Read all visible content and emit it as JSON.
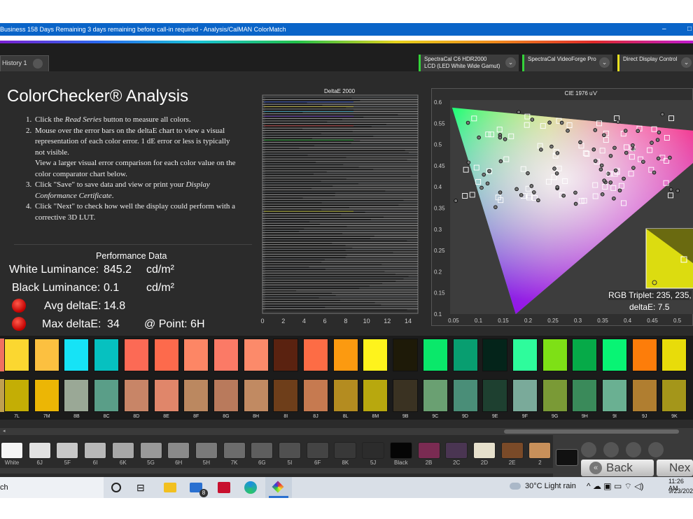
{
  "window": {
    "title": "Business 158 Days Remaining 3 days remaining before call-in required - Analysis/CalMAN ColorMatch",
    "minimize": "–",
    "maximize": "□"
  },
  "tabs": [
    {
      "label": "History 1"
    }
  ],
  "devices": [
    {
      "line1": "SpectraCal C6 HDR2000",
      "line2": "LCD (LED White Wide Gamut)",
      "color": "#34d23a"
    },
    {
      "line1": "SpectraCal VideoForge Pro",
      "line2": "",
      "color": "#34d23a"
    },
    {
      "line1": "Direct Display Control",
      "line2": "",
      "color": "#e8e020"
    }
  ],
  "page_title": "ColorChecker® Analysis",
  "instructions": [
    {
      "n": "1.",
      "html": "Click the <i>Read Series</i> button to measure all colors."
    },
    {
      "n": "2.",
      "html": "Mouse over the error bars on the deltaE chart to view a visual representation of each color error. 1 dE error or less is typically not visible.<br>View a larger visual error comparison for each color value on the color comparator chart below."
    },
    {
      "n": "3.",
      "html": "Click \"Save\" to save data and view or print your <i>Display Conformance Certificate</i>."
    },
    {
      "n": "4.",
      "html": "Click \"Next\" to check how well the display could perform with a corrective 3D LUT."
    }
  ],
  "performance": {
    "heading": "Performance Data",
    "white_label": "White Luminance:",
    "white_value": "845.2",
    "white_unit": "cd/m²",
    "black_label": "Black Luminance:",
    "black_value": "0.1",
    "black_unit": "cd/m²",
    "avg_label": "Avg deltaE:",
    "avg_value": "14.8",
    "max_label": "Max deltaE:",
    "max_value": "34",
    "point_label": "@ Point: 6H"
  },
  "deltae_chart": {
    "title": "DeltaE 2000",
    "xticks": [
      "0",
      "2",
      "4",
      "6",
      "8",
      "10",
      "12",
      "14"
    ]
  },
  "cie_chart": {
    "title": "CIE 1976 u'v'",
    "xticks": [
      "0.05",
      "0.1",
      "0.15",
      "0.2",
      "0.25",
      "0.3",
      "0.35",
      "0.4",
      "0.45",
      "0.5"
    ],
    "yticks": [
      "0.6",
      "0.55",
      "0.5",
      "0.45",
      "0.4",
      "0.35",
      "0.3",
      "0.25",
      "0.2",
      "0.15",
      "0.1"
    ],
    "rgb_triplet": "RGB Triplet: 235, 235,",
    "deltae": "deltaE: 7.5"
  },
  "swatches": [
    {
      "label": "7L",
      "top": "#fbd730",
      "bottom": "#c4ae05"
    },
    {
      "label": "7M",
      "top": "#fcc040",
      "bottom": "#ecb605"
    },
    {
      "label": "8B",
      "top": "#16e3f6",
      "bottom": "#9aa896"
    },
    {
      "label": "8C",
      "top": "#06c1c0",
      "bottom": "#5a9e88"
    },
    {
      "label": "8D",
      "top": "#fc6a55",
      "bottom": "#c88567"
    },
    {
      "label": "8E",
      "top": "#fd6a4c",
      "bottom": "#e0866a"
    },
    {
      "label": "8F",
      "top": "#fd8665",
      "bottom": "#bb8860"
    },
    {
      "label": "8G",
      "top": "#fb7a66",
      "bottom": "#b97a5c"
    },
    {
      "label": "8H",
      "top": "#fc8a6a",
      "bottom": "#c18a62"
    },
    {
      "label": "8I",
      "top": "#5a2210",
      "bottom": "#6e3e1a"
    },
    {
      "label": "8J",
      "top": "#fd6c45",
      "bottom": "#c67a50"
    },
    {
      "label": "8L",
      "top": "#fc9a10",
      "bottom": "#b48c20"
    },
    {
      "label": "8M",
      "top": "#fef31c",
      "bottom": "#b8a80e"
    },
    {
      "label": "9B",
      "top": "#1e1a08",
      "bottom": "#3a3222"
    },
    {
      "label": "9C",
      "top": "#0ae86a",
      "bottom": "#6aa072"
    },
    {
      "label": "9D",
      "top": "#089e70",
      "bottom": "#4a8e78"
    },
    {
      "label": "9E",
      "top": "#04241a",
      "bottom": "#1e4030"
    },
    {
      "label": "9F",
      "top": "#2efc9c",
      "bottom": "#7aaa9a"
    },
    {
      "label": "9G",
      "top": "#7ee016",
      "bottom": "#7a9a36"
    },
    {
      "label": "9H",
      "top": "#06aa48",
      "bottom": "#3a8a5a"
    },
    {
      "label": "9I",
      "top": "#08f474",
      "bottom": "#6ab092"
    },
    {
      "label": "9J",
      "top": "#fd7d0a",
      "bottom": "#b07e30"
    },
    {
      "label": "9K",
      "top": "#e8dc0a",
      "bottom": "#a4961a"
    }
  ],
  "grayscale": [
    {
      "label": "White",
      "color": "#f4f4f4"
    },
    {
      "label": "6J",
      "color": "#e2e2e2"
    },
    {
      "label": "5F",
      "color": "#c8c8c8"
    },
    {
      "label": "6I",
      "color": "#b8b8b8"
    },
    {
      "label": "6K",
      "color": "#a8a8a8"
    },
    {
      "label": "5G",
      "color": "#999999"
    },
    {
      "label": "6H",
      "color": "#8a8a8a"
    },
    {
      "label": "5H",
      "color": "#7a7a7a"
    },
    {
      "label": "7K",
      "color": "#6c6c6c"
    },
    {
      "label": "6G",
      "color": "#5e5e5e"
    },
    {
      "label": "5I",
      "color": "#505050"
    },
    {
      "label": "6F",
      "color": "#444444"
    },
    {
      "label": "8K",
      "color": "#383838"
    },
    {
      "label": "5J",
      "color": "#2c2c2c"
    },
    {
      "label": "Black",
      "color": "#050505"
    },
    {
      "label": "2B",
      "color": "#7a2b52"
    },
    {
      "label": "2C",
      "color": "#4a3552"
    },
    {
      "label": "2D",
      "color": "#e6e0cc"
    },
    {
      "label": "2E",
      "color": "#7a4a28"
    },
    {
      "label": "2",
      "color": "#c8905a"
    }
  ],
  "nav": {
    "back": "Back",
    "next": "Nex"
  },
  "taskbar": {
    "search": "ch",
    "weather": "30°C  Light rain",
    "time": "11:26 AM",
    "date": "9/23/202",
    "mail_badge": "8"
  }
}
